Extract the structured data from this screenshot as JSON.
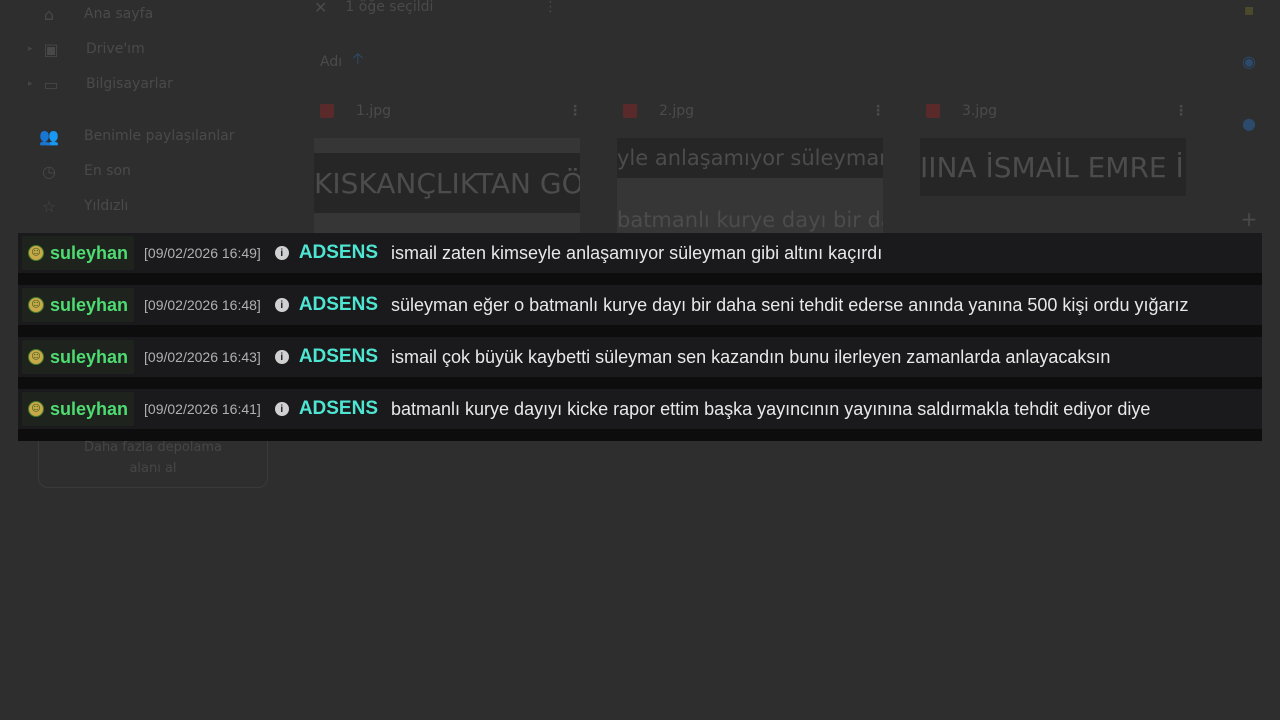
{
  "sidebar": {
    "items": [
      {
        "label": "Ana sayfa",
        "icon": "home-icon",
        "glyph": "⌂",
        "caret": false
      },
      {
        "label": "Drive'ım",
        "icon": "drive-icon",
        "glyph": "▣",
        "caret": true
      },
      {
        "label": "Bilgisayarlar",
        "icon": "computer-icon",
        "glyph": "▭",
        "caret": true
      },
      {
        "label": "Benimle paylaşılanlar",
        "icon": "shared-icon",
        "glyph": "👥",
        "caret": false
      },
      {
        "label": "En son",
        "icon": "clock-icon",
        "glyph": "◷",
        "caret": false
      },
      {
        "label": "Yıldızlı",
        "icon": "star-icon",
        "glyph": "☆",
        "caret": false
      }
    ],
    "storage_line1": "Daha fazla depolama",
    "storage_line2": "alanı al"
  },
  "toolbar": {
    "selection_text": "1 öğe seçildi",
    "close_glyph": "✕",
    "more_glyph": "⋮"
  },
  "sort": {
    "label": "Adı",
    "arrow_glyph": "🡡"
  },
  "files": [
    {
      "name": "1.jpg",
      "preview_text": "KISKANÇLIKTAN GÖ"
    },
    {
      "name": "2.jpg",
      "preview_text": "yle anlaşamıyor süleyman",
      "preview_text2": "batmanlı kurye dayı bir da"
    },
    {
      "name": "3.jpg",
      "preview_text": "IINA İSMAİL EMRE İ"
    }
  ],
  "chat": {
    "messages": [
      {
        "user": "suleyhan",
        "timestamp": "[09/02/2026 16:49]",
        "tag": "ADSENS",
        "text": "ismail zaten kimseyle anlaşamıyor süleyman gibi altını kaçırdı"
      },
      {
        "user": "suleyhan",
        "timestamp": "[09/02/2026 16:48]",
        "tag": "ADSENS",
        "text": "süleyman eğer o batmanlı kurye dayı bir daha seni tehdit ederse anında yanına 500 kişi ordu yığarız"
      },
      {
        "user": "suleyhan",
        "timestamp": "[09/02/2026 16:43]",
        "tag": "ADSENS",
        "text": "ismail çok büyük kaybetti süleyman sen kazandın bunu ilerleyen zamanlarda anlayacaksın"
      },
      {
        "user": "suleyhan",
        "timestamp": "[09/02/2026 16:41]",
        "tag": "ADSENS",
        "text": "batmanlı kurye dayıyı kicke rapor ettim başka yayıncının yayınına saldırmakla tehdit ediyor diye"
      }
    ]
  },
  "colors": {
    "username": "#4edc72",
    "tag": "#4ee6d2",
    "message": "#e8e8e8",
    "timestamp": "#b0b0b0"
  }
}
